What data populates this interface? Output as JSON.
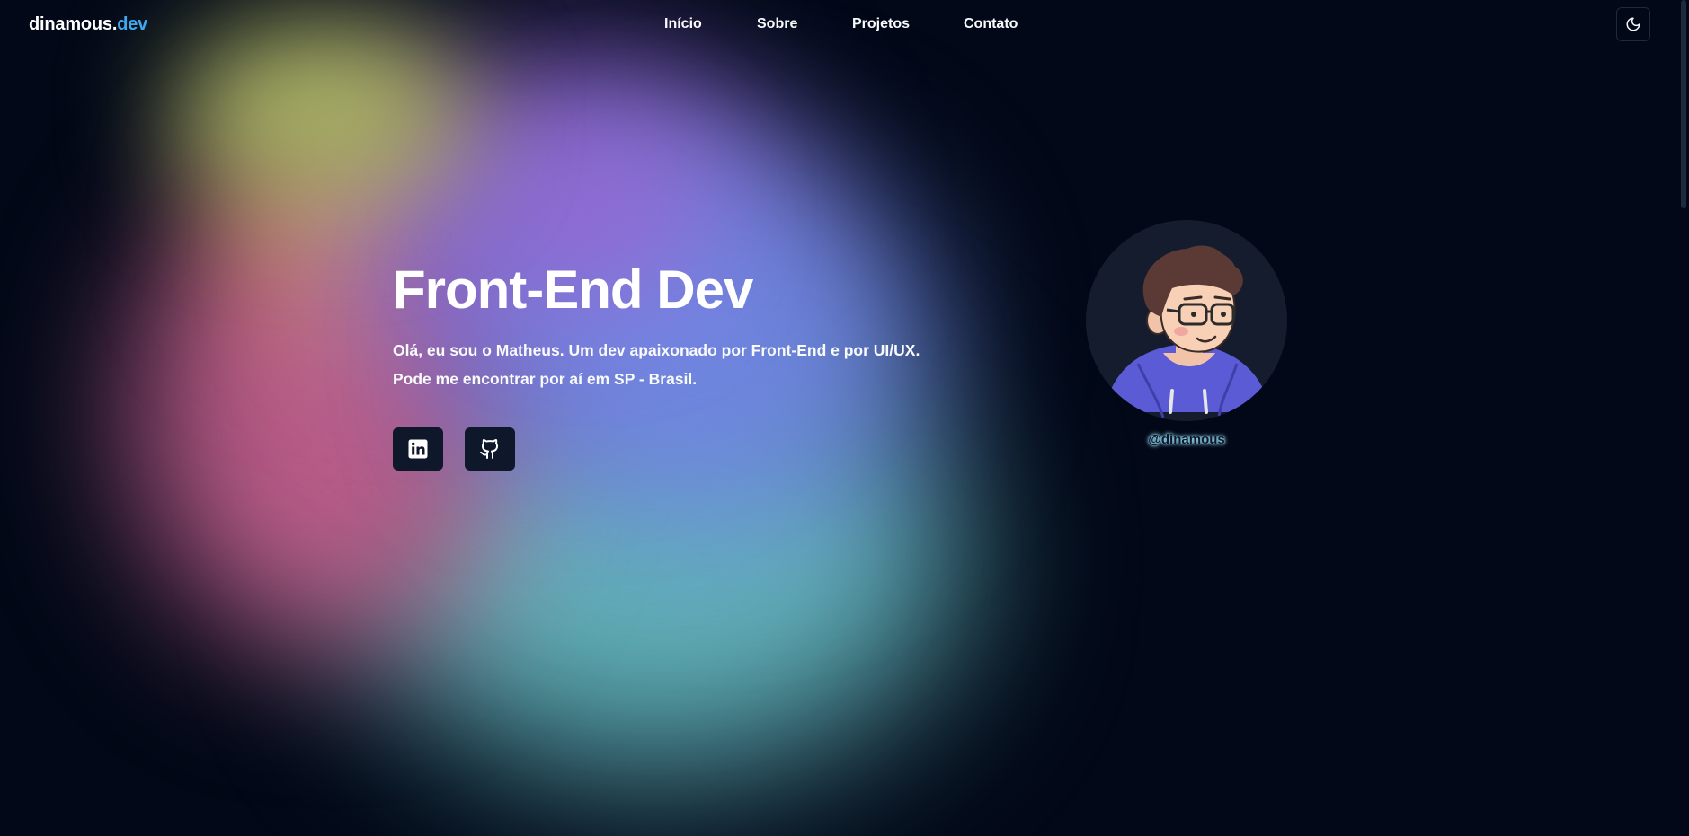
{
  "header": {
    "logo_main": "dinamous.",
    "logo_accent": "dev",
    "nav": [
      {
        "label": "Início"
      },
      {
        "label": "Sobre"
      },
      {
        "label": "Projetos"
      },
      {
        "label": "Contato"
      }
    ],
    "theme_toggle_icon": "moon-icon"
  },
  "hero": {
    "title": "Front-End Dev",
    "description_line1": "Olá, eu sou o Matheus. Um dev apaixonado por Front-End e por UI/UX.",
    "description_line2": "Pode me encontrar por aí em SP - Brasil.",
    "social": [
      {
        "icon": "linkedin-icon"
      },
      {
        "icon": "github-icon"
      }
    ]
  },
  "profile": {
    "handle": "@dinamous",
    "avatar_icon": "cartoon-avatar"
  },
  "colors": {
    "background": "#020817",
    "accent": "#3ea8f0",
    "button_bg": "#0f172a",
    "avatar_bg": "#141c2e",
    "hoodie": "#5b5bd6"
  }
}
